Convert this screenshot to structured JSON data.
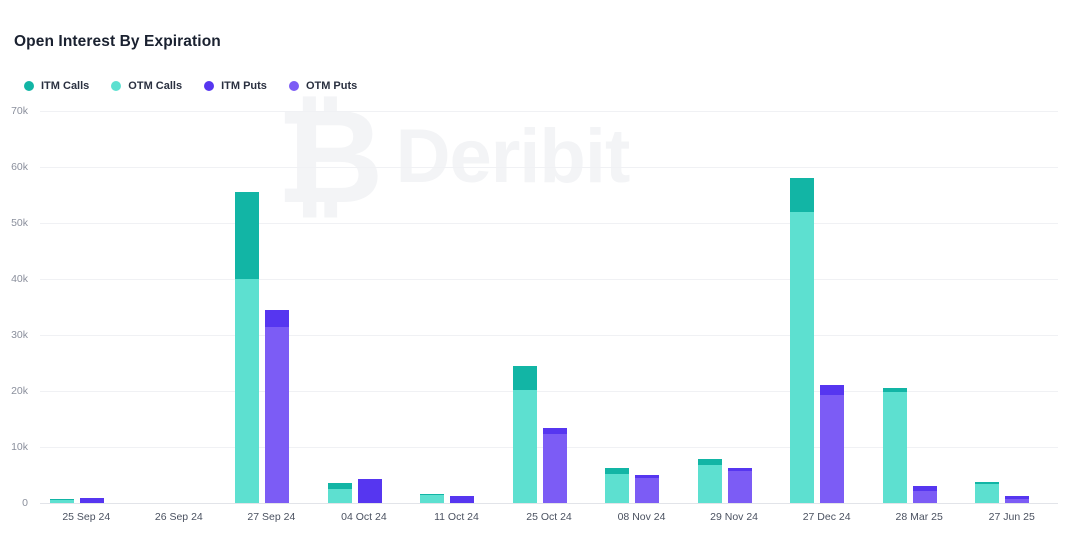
{
  "header": {
    "title": "Open Interest By Expiration"
  },
  "watermark": {
    "symbol": "₿",
    "text": "Deribit"
  },
  "legend": [
    {
      "label": "ITM Calls",
      "color": "#12b5a5",
      "icon": "legend-dot-icon"
    },
    {
      "label": "OTM Calls",
      "color": "#5de0d0",
      "icon": "legend-dot-icon"
    },
    {
      "label": "ITM Puts",
      "color": "#5636f0",
      "icon": "legend-dot-icon"
    },
    {
      "label": "OTM Puts",
      "color": "#7c5cf5",
      "icon": "legend-dot-icon"
    }
  ],
  "chart_data": {
    "type": "bar",
    "title": "Open Interest By Expiration",
    "xlabel": "",
    "ylabel": "",
    "ylim": [
      0,
      70000
    ],
    "yticks": [
      0,
      10000,
      20000,
      30000,
      40000,
      50000,
      60000,
      70000
    ],
    "ytick_labels": [
      "0",
      "10k",
      "20k",
      "30k",
      "40k",
      "50k",
      "60k",
      "70k"
    ],
    "grid": true,
    "stacked": true,
    "grouped": true,
    "legend_position": "top-left",
    "categories": [
      "25 Sep 24",
      "26 Sep 24",
      "27 Sep 24",
      "04 Oct 24",
      "11 Oct 24",
      "25 Oct 24",
      "08 Nov 24",
      "29 Nov 24",
      "27 Dec 24",
      "28 Mar 25",
      "27 Jun 25"
    ],
    "series": [
      {
        "name": "ITM Calls",
        "color": "#12b5a5",
        "group": "calls",
        "values": [
          100,
          0,
          15500,
          1100,
          150,
          4300,
          1200,
          1100,
          6000,
          800,
          300
        ]
      },
      {
        "name": "OTM Calls",
        "color": "#5de0d0",
        "group": "calls",
        "values": [
          600,
          0,
          40000,
          2500,
          1450,
          20200,
          5100,
          6700,
          52000,
          19800,
          3400
        ]
      },
      {
        "name": "ITM Puts",
        "color": "#5636f0",
        "group": "puts",
        "values": [
          900,
          0,
          3000,
          4200,
          1300,
          1000,
          500,
          400,
          1800,
          900,
          400
        ]
      },
      {
        "name": "OTM Puts",
        "color": "#7c5cf5",
        "group": "puts",
        "values": [
          0,
          0,
          31500,
          0,
          0,
          12400,
          4500,
          5800,
          19200,
          2100,
          800
        ]
      }
    ],
    "totals": {
      "calls": [
        700,
        0,
        55500,
        3600,
        1600,
        24500,
        6300,
        7800,
        58000,
        20600,
        3700
      ],
      "puts": [
        900,
        0,
        34500,
        4200,
        1300,
        13400,
        5000,
        6200,
        21000,
        3000,
        1200
      ]
    }
  }
}
